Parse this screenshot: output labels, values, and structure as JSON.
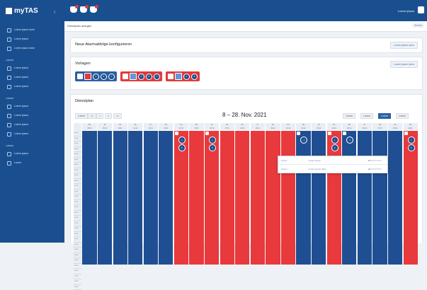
{
  "app": {
    "name": "myTAS"
  },
  "topbar": {
    "user": "Lorem ipsum"
  },
  "breadcrumb": {
    "text": "Dienstplan anlegen",
    "action": "Zurück"
  },
  "sidebar": {
    "sections": [
      {
        "title": "",
        "items": [
          "Lorem ipsum dolor",
          "Lorem ipsum",
          "Lorem ipsum dolor"
        ]
      },
      {
        "title": "LOREM",
        "items": [
          "Lorem ipsum",
          "Lorem ipsum",
          "Lorem ipsum"
        ]
      },
      {
        "title": "LOREM",
        "items": [
          "Lorem ipsum",
          "Lorem ipsum",
          "Lorem ipsum",
          "Lorem ipsum"
        ]
      },
      {
        "title": "LOREM",
        "items": [
          "Lorem ipsum",
          "Lorem"
        ]
      }
    ]
  },
  "alarm_card": {
    "title": "Neue Alarmabfolge konfigurieren",
    "button": "Lorem ipsum dolor"
  },
  "presets_card": {
    "title": "Vorlagen",
    "button": "Lorem ipsum dolor",
    "presets": [
      {
        "color": "blue",
        "labels": [
          "A",
          "B",
          "C"
        ]
      },
      {
        "color": "red",
        "labels": [
          "A",
          "B",
          "C"
        ]
      },
      {
        "color": "red",
        "labels": [
          "A",
          "B"
        ]
      }
    ]
  },
  "schedule": {
    "title": "Dienstplan",
    "range": "8 – 28. Nov. 2021",
    "nav": [
      "Lorem",
      "<<",
      "<",
      ">",
      ">>"
    ],
    "views": [
      "Lorem",
      "Lorem",
      "Lorem",
      "Lorem"
    ],
    "active_view": 2,
    "colors": {
      "blue": "#1f4f92",
      "red": "#e8393d"
    },
    "times": [
      "00:00",
      "01:00",
      "02:00",
      "03:00",
      "04:00",
      "05:00",
      "06:00",
      "07:00",
      "08:00",
      "09:00",
      "10:00",
      "11:00",
      "12:00",
      "13:00",
      "14:00",
      "15:00",
      "16:00",
      "17:00",
      "18:00",
      "19:00",
      "20:00",
      "21:00",
      "22:00",
      "23:00",
      "24:00",
      "25:00",
      "26:00",
      "27:00",
      "28:00",
      "29:00"
    ],
    "days": [
      {
        "dow": "Mo",
        "date": "08.11",
        "color": "b",
        "circles": []
      },
      {
        "dow": "Di",
        "date": "09.11",
        "color": "b",
        "circles": []
      },
      {
        "dow": "Mi",
        "date": "10.11",
        "color": "b",
        "circles": []
      },
      {
        "dow": "Do",
        "date": "11.11",
        "color": "b",
        "circles": []
      },
      {
        "dow": "Fr",
        "date": "12.11",
        "color": "b",
        "circles": []
      },
      {
        "dow": "Sa",
        "date": "13.11",
        "color": "b",
        "circles": []
      },
      {
        "dow": "So",
        "date": "14.11",
        "color": "r",
        "circles": [
          "A",
          "B"
        ],
        "mark": true
      },
      {
        "dow": "Mo",
        "date": "15.11",
        "color": "r",
        "circles": []
      },
      {
        "dow": "Di",
        "date": "16.11",
        "color": "r",
        "circles": [
          "A",
          "B"
        ],
        "mark": true
      },
      {
        "dow": "Mi",
        "date": "17.11",
        "color": "r",
        "circles": []
      },
      {
        "dow": "Do",
        "date": "18.11",
        "color": "r",
        "circles": []
      },
      {
        "dow": "Fr",
        "date": "19.11",
        "color": "r",
        "circles": []
      },
      {
        "dow": "Sa",
        "date": "20.11",
        "color": "r",
        "circles": []
      },
      {
        "dow": "So",
        "date": "21.11",
        "color": "r",
        "circles": []
      },
      {
        "dow": "Mo",
        "date": "22.11",
        "color": "b",
        "circles": [
          "A"
        ],
        "mark": true
      },
      {
        "dow": "Di",
        "date": "23.11",
        "color": "b",
        "circles": []
      },
      {
        "dow": "Mi",
        "date": "24.11",
        "color": "r",
        "circles": [
          "A",
          "B"
        ],
        "mark": true
      },
      {
        "dow": "Do",
        "date": "25.11",
        "color": "b",
        "circles": [
          "A"
        ],
        "mark": true
      },
      {
        "dow": "Fr",
        "date": "26.11",
        "color": "b",
        "circles": []
      },
      {
        "dow": "Sa",
        "date": "27.11",
        "color": "b",
        "circles": []
      },
      {
        "dow": "So",
        "date": "28.11",
        "color": "b",
        "circles": []
      },
      {
        "dow": "Mo",
        "date": "29.11",
        "color": "r",
        "circles": [
          "A",
          "B"
        ],
        "mark": true
      }
    ],
    "popup": {
      "rows": [
        {
          "a": "Lorem",
          "b": "Lorem ipsum"
        },
        {
          "a": "Lorem",
          "b": "Lorem ipsum dolor"
        }
      ]
    }
  }
}
